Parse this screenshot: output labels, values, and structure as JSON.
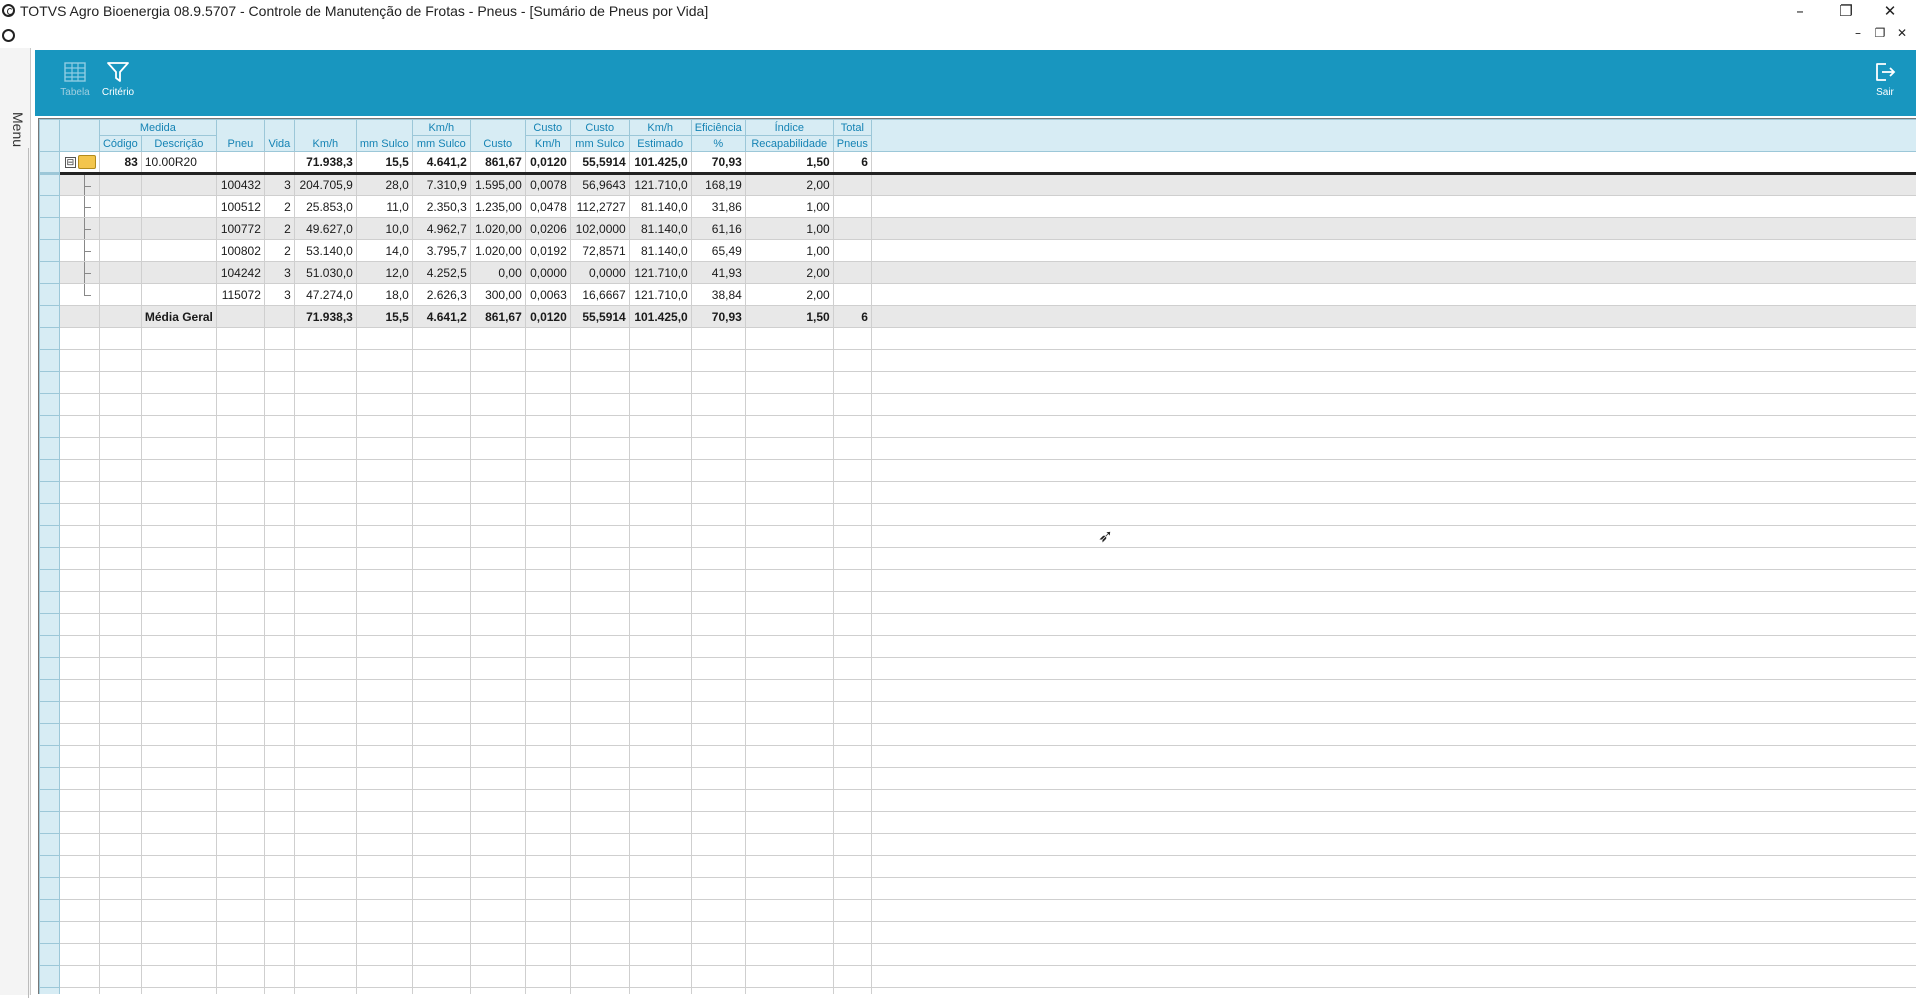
{
  "window": {
    "title": "TOTVS Agro Bioenergia 08.9.5707 - Controle de Manutenção de Frotas - Pneus - [Sumário de Pneus por Vida]",
    "minimize": "–",
    "restore": "❐",
    "close": "✕"
  },
  "mdi": {
    "minimize": "–",
    "restore": "❐",
    "close": "✕"
  },
  "menu": {
    "label": "Menu"
  },
  "toolbar": {
    "tabela_label": "Tabela",
    "criterio_label": "Critério",
    "sair_label": "Sair"
  },
  "colors": {
    "toolbar": "#1896bf",
    "header_bg": "#d7ecf4",
    "header_text": "#1583b4",
    "alt_row": "#e8e8e8"
  },
  "headers": {
    "medida": "Medida",
    "codigo": "Código",
    "descricao": "Descrição",
    "pneu": "Pneu",
    "vida": "Vida",
    "kmh": "Km/h",
    "mm_sulco": "mm Sulco",
    "kmh_mm_1": "Km/h",
    "kmh_mm_2": "mm Sulco",
    "custo": "Custo",
    "custo_km_1": "Custo",
    "custo_km_2": "Km/h",
    "custo_mm_1": "Custo",
    "custo_mm_2": "mm Sulco",
    "kmh_est_1": "Km/h",
    "kmh_est_2": "Estimado",
    "efic_1": "Eficiência",
    "efic_2": "%",
    "indice_1": "Índice",
    "indice_2": "Recapabilidade",
    "total_1": "Total",
    "total_2": "Pneus"
  },
  "group": {
    "expander": "⊟",
    "codigo": "83",
    "descricao": "10.00R20",
    "pneu": "",
    "vida": "",
    "kmh": "71.938,3",
    "mm_sulco": "15,5",
    "kmh_mm": "4.641,2",
    "custo": "861,67",
    "custo_km": "0,0120",
    "custo_mm": "55,5914",
    "kmh_est": "101.425,0",
    "efic": "70,93",
    "indice": "1,50",
    "total": "6"
  },
  "rows": [
    {
      "pneu": "100432",
      "vida": "3",
      "kmh": "204.705,9",
      "mm_sulco": "28,0",
      "kmh_mm": "7.310,9",
      "custo": "1.595,00",
      "custo_km": "0,0078",
      "custo_mm": "56,9643",
      "kmh_est": "121.710,0",
      "efic": "168,19",
      "indice": "2,00",
      "total": ""
    },
    {
      "pneu": "100512",
      "vida": "2",
      "kmh": "25.853,0",
      "mm_sulco": "11,0",
      "kmh_mm": "2.350,3",
      "custo": "1.235,00",
      "custo_km": "0,0478",
      "custo_mm": "112,2727",
      "kmh_est": "81.140,0",
      "efic": "31,86",
      "indice": "1,00",
      "total": ""
    },
    {
      "pneu": "100772",
      "vida": "2",
      "kmh": "49.627,0",
      "mm_sulco": "10,0",
      "kmh_mm": "4.962,7",
      "custo": "1.020,00",
      "custo_km": "0,0206",
      "custo_mm": "102,0000",
      "kmh_est": "81.140,0",
      "efic": "61,16",
      "indice": "1,00",
      "total": ""
    },
    {
      "pneu": "100802",
      "vida": "2",
      "kmh": "53.140,0",
      "mm_sulco": "14,0",
      "kmh_mm": "3.795,7",
      "custo": "1.020,00",
      "custo_km": "0,0192",
      "custo_mm": "72,8571",
      "kmh_est": "81.140,0",
      "efic": "65,49",
      "indice": "1,00",
      "total": ""
    },
    {
      "pneu": "104242",
      "vida": "3",
      "kmh": "51.030,0",
      "mm_sulco": "12,0",
      "kmh_mm": "4.252,5",
      "custo": "0,00",
      "custo_km": "0,0000",
      "custo_mm": "0,0000",
      "kmh_est": "121.710,0",
      "efic": "41,93",
      "indice": "2,00",
      "total": ""
    },
    {
      "pneu": "115072",
      "vida": "3",
      "kmh": "47.274,0",
      "mm_sulco": "18,0",
      "kmh_mm": "2.626,3",
      "custo": "300,00",
      "custo_km": "0,0063",
      "custo_mm": "16,6667",
      "kmh_est": "121.710,0",
      "efic": "38,84",
      "indice": "2,00",
      "total": ""
    }
  ],
  "average": {
    "label": "Média Geral",
    "kmh": "71.938,3",
    "mm_sulco": "15,5",
    "kmh_mm": "4.641,2",
    "custo": "861,67",
    "custo_km": "0,0120",
    "custo_mm": "55,5914",
    "kmh_est": "101.425,0",
    "efic": "70,93",
    "indice": "1,50",
    "total": "6"
  }
}
